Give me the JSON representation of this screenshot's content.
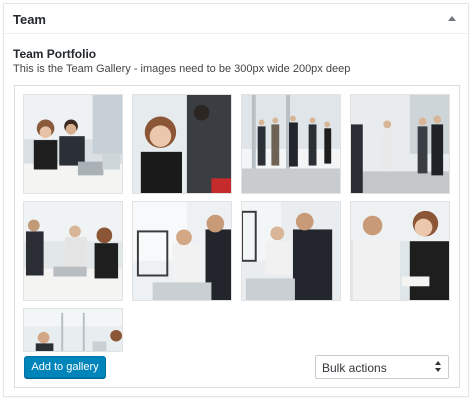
{
  "metabox": {
    "title": "Team",
    "toggle_icon": "triangle-up-icon"
  },
  "section": {
    "title": "Team Portfolio",
    "description": "This is the Team Gallery - images need to be 300px wide 200px deep"
  },
  "gallery": {
    "image_count": 9,
    "images": [
      {
        "subject": "team-meeting-laptop-photo"
      },
      {
        "subject": "woman-smiling-office-photo"
      },
      {
        "subject": "group-standing-window-photo"
      },
      {
        "subject": "people-walking-office-photo"
      },
      {
        "subject": "group-table-discussion-photo"
      },
      {
        "subject": "two-men-laptop-photo"
      },
      {
        "subject": "men-reviewing-document-photo"
      },
      {
        "subject": "woman-man-smiling-photo"
      },
      {
        "subject": "office-meeting-partial-photo"
      }
    ]
  },
  "actions": {
    "add_label": "Add to gallery",
    "bulk_label": "Bulk actions",
    "accent_color": "#0085ba"
  }
}
